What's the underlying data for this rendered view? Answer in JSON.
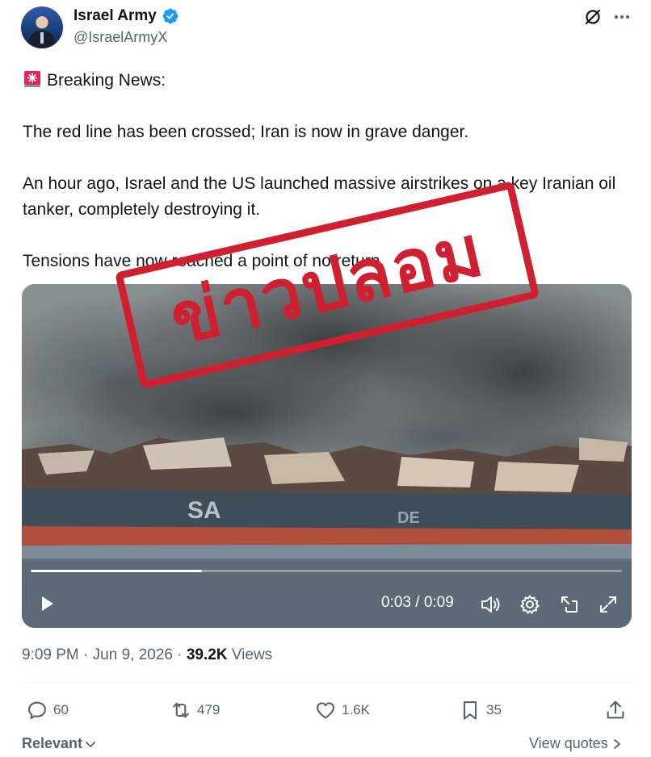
{
  "author": {
    "display_name": "Israel Army",
    "handle": "@IsraelArmyX",
    "verified": true
  },
  "post": {
    "lines": [
      "Breaking News:",
      "The red line has been crossed; Iran is now in grave danger.",
      "An hour ago, Israel and the US launched massive airstrikes on a key Iranian oil tanker, completely destroying it.",
      "Tensions have now reached a point of no return."
    ],
    "emoji": "siren-icon"
  },
  "media": {
    "stamp_text": "ข่าวปลอม",
    "ship_text_1": "SA",
    "ship_text_2": "DE",
    "time_display": "0:03 / 0:09",
    "progress": 0.29
  },
  "meta": {
    "time": "9:09 PM",
    "sep1": " · ",
    "date": "Jun 9, 2026",
    "sep2": " · ",
    "views_count": "39.2K",
    "views_label": " Views"
  },
  "actions": {
    "replies": "60",
    "reposts": "479",
    "likes": "1.6K",
    "bookmarks": "35"
  },
  "footer": {
    "sort_label": "Relevant",
    "quotes_label": "View quotes"
  },
  "colors": {
    "accent": "#1d9bf0",
    "stamp": "#d0202f",
    "muted": "#536471"
  }
}
